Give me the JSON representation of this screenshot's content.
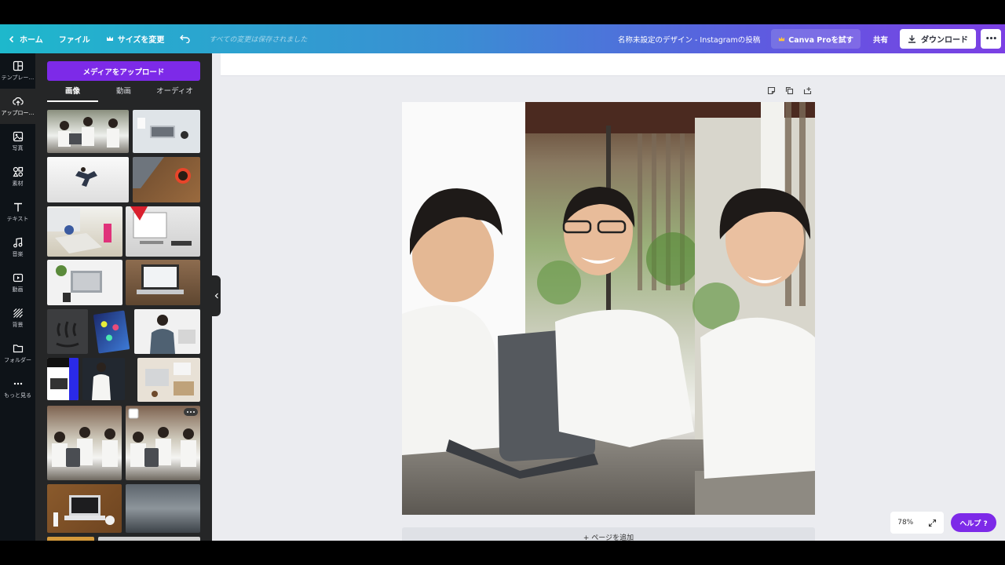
{
  "topbar": {
    "home_label": "ホーム",
    "file_label": "ファイル",
    "resize_label": "サイズを変更",
    "save_status": "すべての変更は保存されました",
    "design_title": "名称未設定のデザイン - Instagramの投稿",
    "pro_label": "Canva Proを試す",
    "share_label": "共有",
    "download_label": "ダウンロード",
    "more_label": "•••"
  },
  "rail": {
    "items": [
      {
        "label": "テンプレー…",
        "icon": "template-icon"
      },
      {
        "label": "アップロー…",
        "icon": "upload-cloud-icon"
      },
      {
        "label": "写真",
        "icon": "photo-icon"
      },
      {
        "label": "素材",
        "icon": "elements-icon"
      },
      {
        "label": "テキスト",
        "icon": "text-icon"
      },
      {
        "label": "音楽",
        "icon": "music-icon"
      },
      {
        "label": "動画",
        "icon": "video-icon"
      },
      {
        "label": "背景",
        "icon": "background-icon"
      },
      {
        "label": "フォルダー",
        "icon": "folder-icon"
      },
      {
        "label": "もっと見る",
        "icon": "more-dots-icon"
      }
    ]
  },
  "panel": {
    "upload_button": "メディアをアップロード",
    "tabs": [
      {
        "label": "画像",
        "active": true
      },
      {
        "label": "動画",
        "active": false
      },
      {
        "label": "オーディオ",
        "active": false
      }
    ]
  },
  "canvas": {
    "add_page_label": "+ ページを追加",
    "zoom_level": "78%",
    "help_label": "ヘルプ ?"
  },
  "colors": {
    "accent": "#7d2ae8",
    "gradient_start": "#1eb8cc",
    "gradient_end": "#7b3fe4",
    "rail_bg": "#0e1318",
    "panel_bg": "#252627"
  }
}
